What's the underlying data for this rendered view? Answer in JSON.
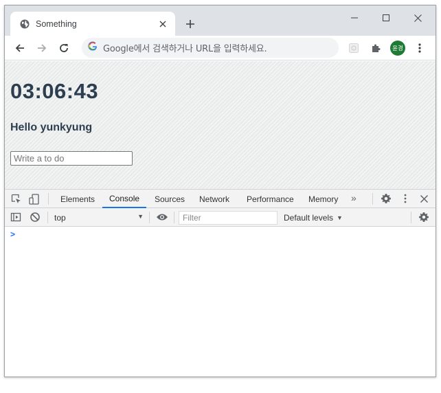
{
  "browser": {
    "tab": {
      "title": "Something"
    },
    "omnibox": {
      "placeholder": "Google에서 검색하거나 URL을 입력하세요."
    },
    "profile": {
      "initials": "윤경"
    }
  },
  "page": {
    "clock": "03:06:43",
    "greeting": "Hello yunkyung",
    "todo_placeholder": "Write a to do"
  },
  "devtools": {
    "tabs": [
      "Elements",
      "Console",
      "Sources",
      "Network",
      "Performance",
      "Memory"
    ],
    "active_tab": "Console",
    "more_tabs": "»",
    "context": "top",
    "filter_placeholder": "Filter",
    "levels": "Default levels",
    "prompt": ">"
  },
  "colors": {
    "accent": "#1a73e8",
    "heading": "#2c3e50",
    "profile": "#1e7a34"
  }
}
